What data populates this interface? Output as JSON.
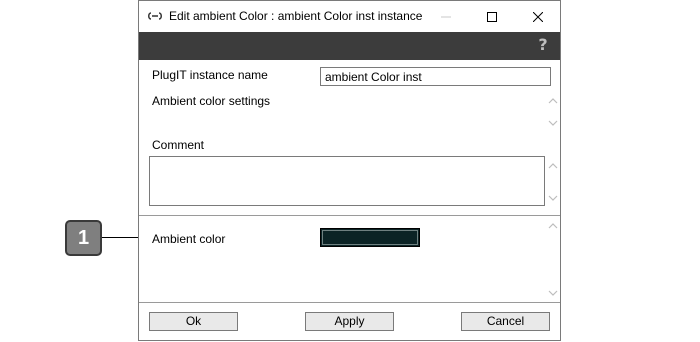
{
  "window": {
    "title": "Edit ambient Color : ambient Color inst instance",
    "help_glyph": "?"
  },
  "form": {
    "instance_name_label": "PlugIT instance name",
    "instance_name_value": "ambient Color inst",
    "settings_label": "Ambient color settings",
    "comment_label": "Comment",
    "comment_value": "",
    "ambient_color_label": "Ambient color",
    "ambient_color_value": "#0b2325"
  },
  "buttons": {
    "ok": "Ok",
    "apply": "Apply",
    "cancel": "Cancel"
  },
  "callout": {
    "number": "1"
  },
  "icons": {
    "app": "link-icon",
    "minimize": "minimize-icon",
    "maximize": "maximize-icon",
    "close": "close-icon",
    "help": "help-icon"
  }
}
